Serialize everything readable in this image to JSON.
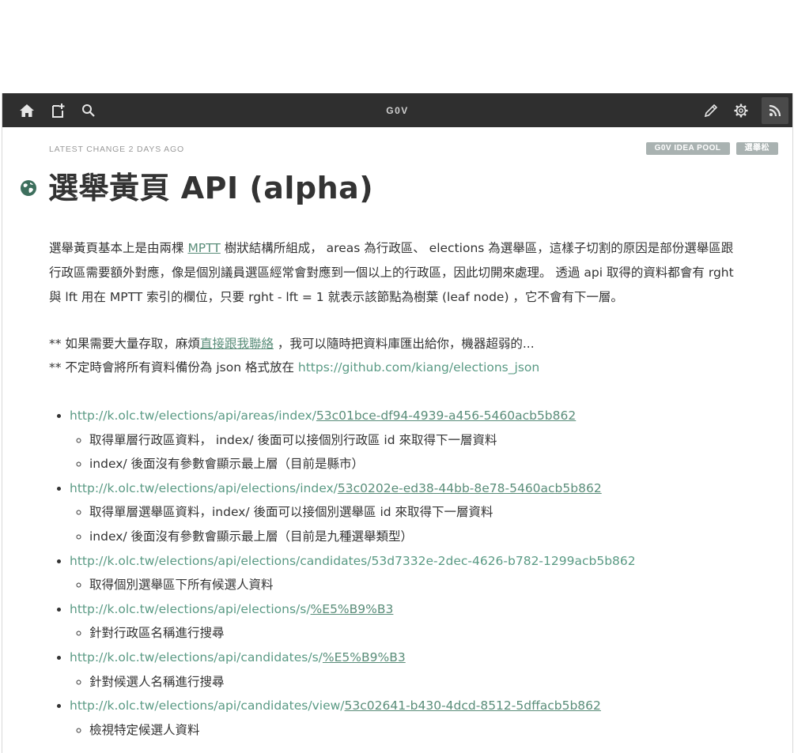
{
  "app": {
    "site_title": "G0V",
    "nav_icons": [
      "home-icon",
      "add-page-icon",
      "search-icon",
      "edit-icon",
      "gear-icon",
      "rss-icon"
    ]
  },
  "page": {
    "latest_change": "LATEST CHANGE 2 DAYS AGO",
    "tags": [
      "G0V IDEA POOL",
      "選舉松"
    ],
    "title": "選舉黃頁 API (alpha)",
    "intro": {
      "t1": "選舉黃頁基本上是由兩棵 ",
      "mptt": "MPTT",
      "t2": " 樹狀結構所組成， areas 為行政區、 elections 為選舉區，這樣子切割的原因是部份選舉區跟行政區需要額外對應，像是個別議員選區經常會對應到一個以上的行政區，因此切開來處理。 透過 api 取得的資料都會有 rght 與 lft 用在 MPTT 索引的欄位，只要 rght - lft = 1 就表示該節點為樹葉 (leaf node) ，它不會有下一層。"
    },
    "notes": {
      "n1_prefix": "** 如果需要大量存取，麻煩",
      "n1_link": "直接跟我聯絡",
      "n1_suffix": " ，我可以隨時把資料庫匯出給你，機器超弱的...",
      "n2_prefix": "** 不定時會將所有資料備份為 json 格式放在 ",
      "n2_link": "https://github.com/kiang/elections_json"
    },
    "endpoints": [
      {
        "base": "http://k.olc.tw/elections/api/areas/index/",
        "tail": "53c01bce-df94-4939-a456-5460acb5b862",
        "subs": [
          "取得單層行政區資料， index/ 後面可以接個別行政區 id 來取得下一層資料",
          "index/ 後面沒有參數會顯示最上層（目前是縣市）"
        ]
      },
      {
        "base": "http://k.olc.tw/elections/api/elections/index/",
        "tail": "53c0202e-ed38-44bb-8e78-5460acb5b862",
        "subs": [
          "取得單層選舉區資料，index/ 後面可以接個別選舉區 id 來取得下一層資料",
          "index/ 後面沒有參數會顯示最上層（目前是九種選舉類型）"
        ]
      },
      {
        "base": "http://k.olc.tw/elections/api/elections/candidates/53d7332e-2dec-4626-b782-1299acb5b862",
        "tail": "",
        "subs": [
          "取得個別選舉區下所有候選人資料"
        ]
      },
      {
        "base": "http://k.olc.tw/elections/api/elections/s/",
        "tail": "%E5%B9%B3",
        "subs": [
          "針對行政區名稱進行搜尋"
        ]
      },
      {
        "base": "http://k.olc.tw/elections/api/candidates/s/",
        "tail": "%E5%B9%B3",
        "subs": [
          "針對候選人名稱進行搜尋"
        ]
      },
      {
        "base": "http://k.olc.tw/elections/api/candidates/view/",
        "tail": "53c02641-b430-4dcd-8512-5dffacb5b862",
        "subs": [
          "檢視特定候選人資料"
        ]
      }
    ]
  },
  "colors": {
    "topbar": "#2f2f2f",
    "link": "#5a9a84",
    "tag": "#a9b2b1",
    "text": "#333333"
  }
}
